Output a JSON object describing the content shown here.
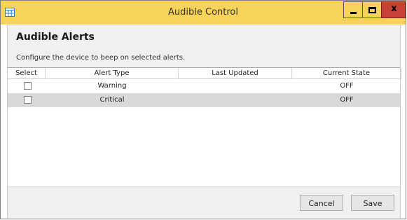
{
  "window": {
    "title": "Audible Control",
    "title_bar_color": "#f7d35a",
    "close_button_color": "#c74137",
    "close_glyph": "x"
  },
  "panel": {
    "heading": "Audible Alerts",
    "description": "Configure the device to beep on selected alerts."
  },
  "grid": {
    "columns": [
      "Select",
      "Alert Type",
      "Last Updated",
      "Current State"
    ],
    "rows": [
      {
        "checked": false,
        "alert_type": "Warning",
        "last_updated": "",
        "current_state": "OFF",
        "selected": false
      },
      {
        "checked": false,
        "alert_type": "Critical",
        "last_updated": "",
        "current_state": "OFF",
        "selected": true
      }
    ]
  },
  "buttons": {
    "cancel": "Cancel",
    "save": "Save"
  }
}
